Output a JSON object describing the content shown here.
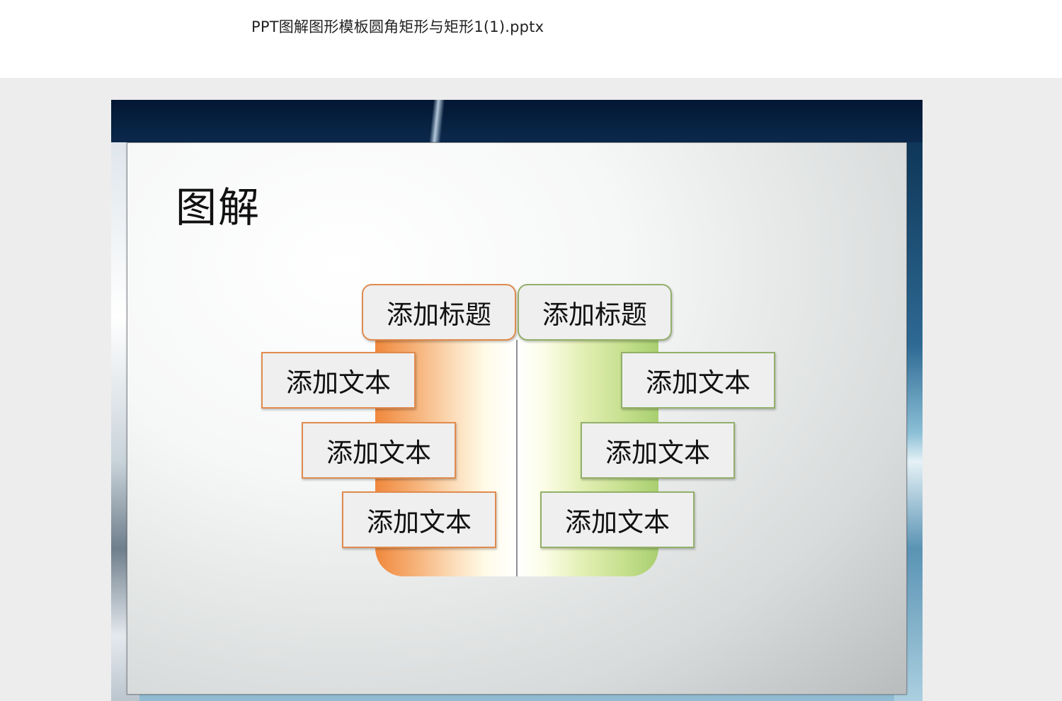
{
  "header": {
    "filename": "PPT图解图形模板圆角矩形与矩形1(1).pptx"
  },
  "slide": {
    "title": "图解",
    "left_title": "添加标题",
    "right_title": "添加标题",
    "left_items": [
      "添加文本",
      "添加文本",
      "添加文本"
    ],
    "right_items": [
      "添加文本",
      "添加文本",
      "添加文本"
    ]
  },
  "colors": {
    "orange_accent": "#e08b4e",
    "green_accent": "#93b06a",
    "viewer_background": "#ededed"
  }
}
